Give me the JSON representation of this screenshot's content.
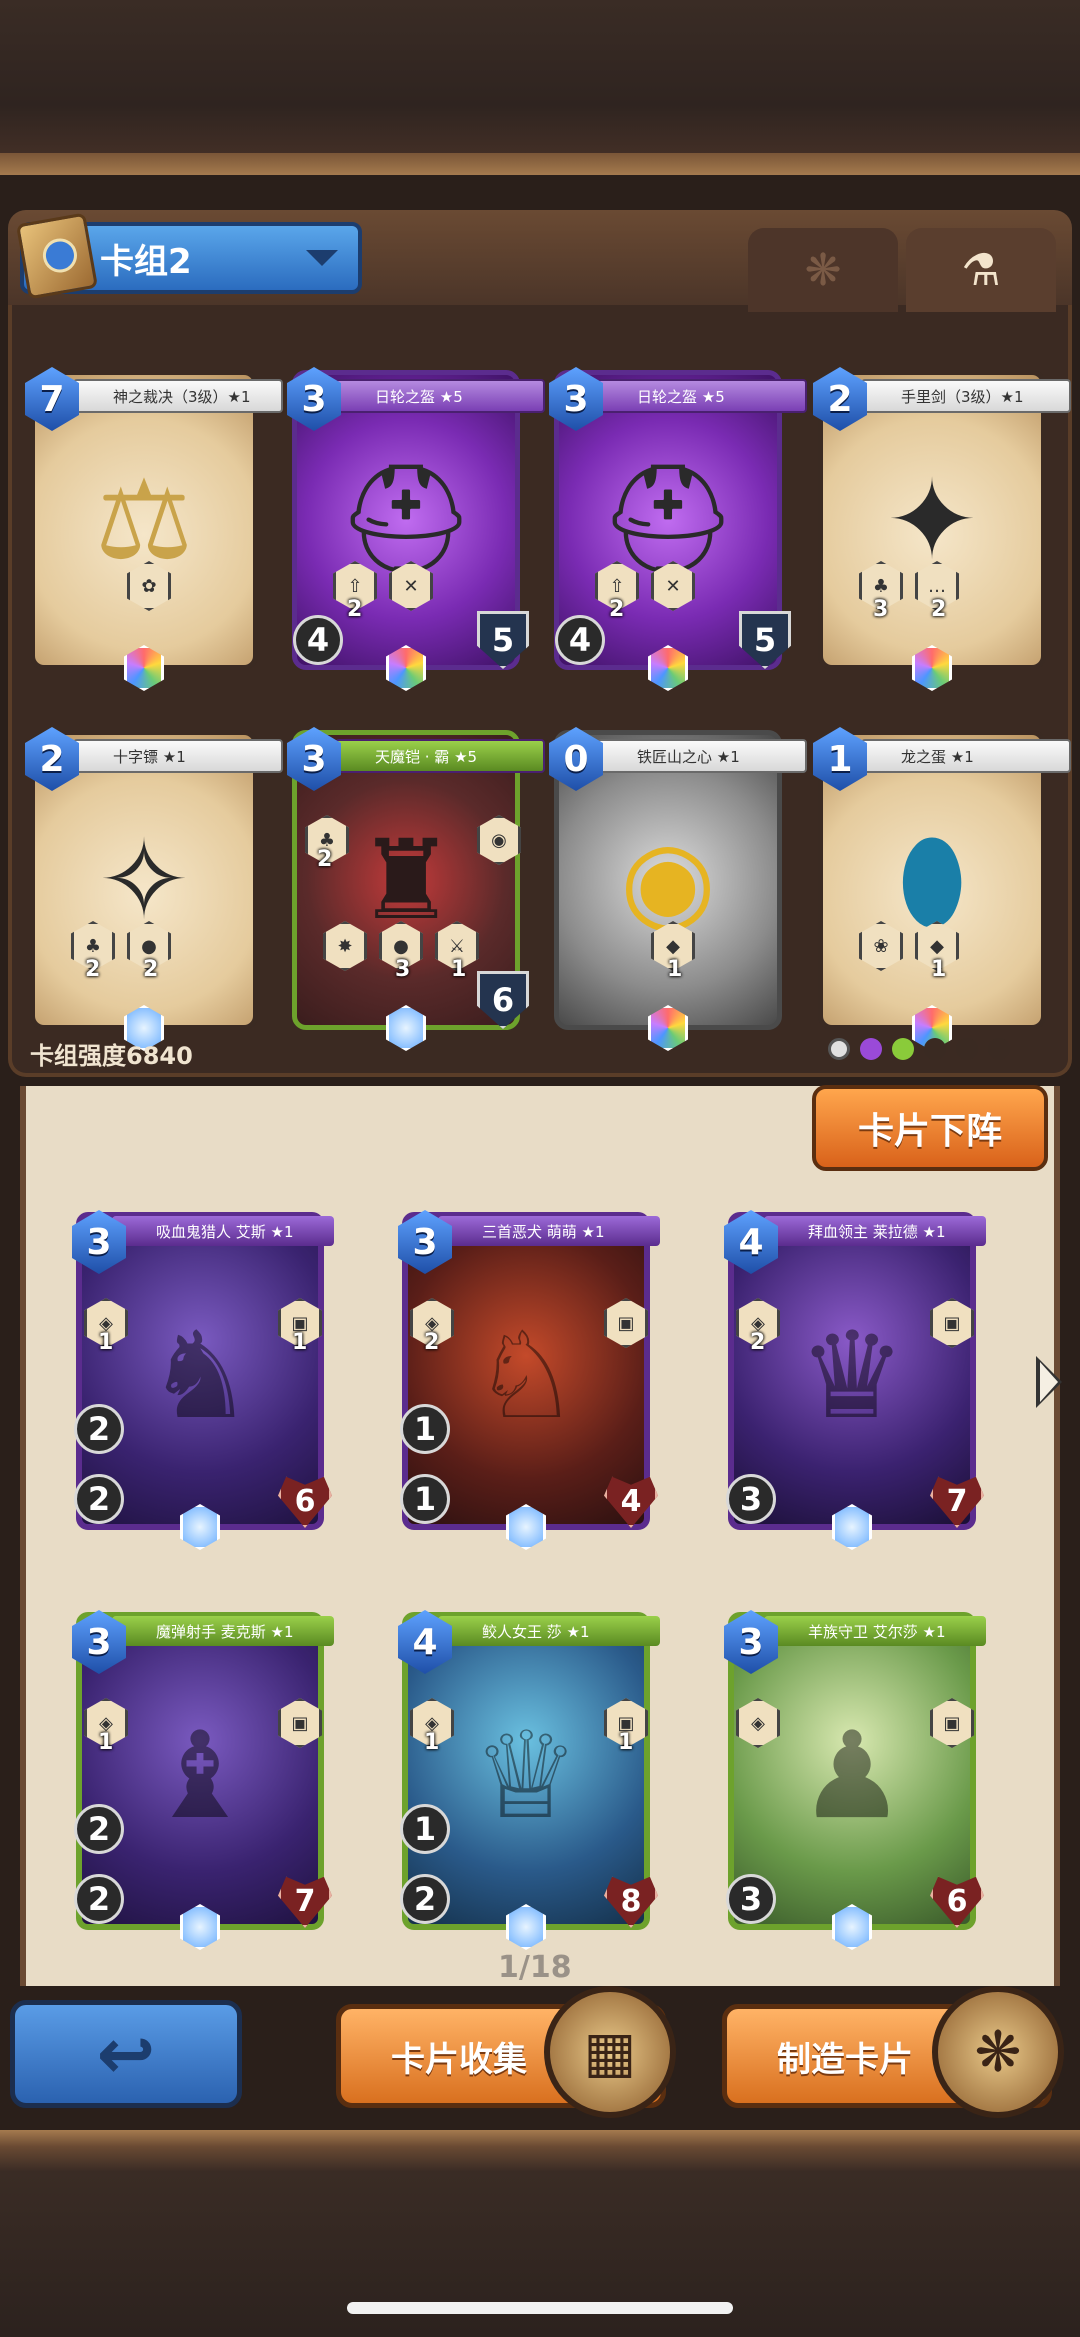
{
  "deck": {
    "name": "卡组2",
    "strength_label": "卡组强度6840"
  },
  "tabs": {
    "pets_icon": "paw-icon",
    "potions_icon": "potion-icon"
  },
  "deck_cards": [
    {
      "cost": "7",
      "name": "神之裁决（3级）★1"
    },
    {
      "cost": "3",
      "name": "日轮之盔 ★5",
      "stat_left": "4",
      "stat_right": "5",
      "skill_a": "2"
    },
    {
      "cost": "3",
      "name": "日轮之盔 ★5",
      "stat_left": "4",
      "stat_right": "5",
      "skill_a": "2"
    },
    {
      "cost": "2",
      "name": "手里剑（3级）★1",
      "skill_a": "3",
      "skill_b": "2"
    },
    {
      "cost": "2",
      "name": "十字镖 ★1",
      "skill_a": "2",
      "skill_b": "2"
    },
    {
      "cost": "3",
      "name": "天魔铠 · 霸 ★5",
      "skill_side": "2",
      "skill_b": "3",
      "skill_c": "1",
      "stat_right": "6"
    },
    {
      "cost": "0",
      "name": "铁匠山之心 ★1",
      "skill_b": "1"
    },
    {
      "cost": "1",
      "name": "龙之蛋 ★1",
      "skill_b": "1"
    }
  ],
  "unload_button": "卡片下阵",
  "collection_cards": [
    {
      "cost": "3",
      "name": "吸血鬼猎人 艾斯 ★1",
      "s1": "1",
      "s2": "1",
      "atk": "2",
      "def": "2",
      "hp": "6"
    },
    {
      "cost": "3",
      "name": "三首恶犬 萌萌 ★1",
      "s1": "2",
      "s2": "",
      "atk": "1",
      "def": "1",
      "hp": "4"
    },
    {
      "cost": "4",
      "name": "拜血领主 莱拉德 ★1",
      "s1": "2",
      "s2": "",
      "atk": "",
      "def": "3",
      "hp": "7"
    },
    {
      "cost": "3",
      "name": "魔弹射手 麦克斯 ★1",
      "s1": "1",
      "s2": "",
      "atk": "2",
      "def": "2",
      "hp": "7"
    },
    {
      "cost": "4",
      "name": "鲛人女王 莎 ★1",
      "s1": "1",
      "s2": "1",
      "atk": "1",
      "def": "2",
      "hp": "8"
    },
    {
      "cost": "3",
      "name": "羊族守卫 艾尔莎 ★1",
      "s1": "",
      "s2": "",
      "atk": "",
      "def": "3",
      "hp": "6"
    }
  ],
  "pagination": "1/18",
  "bottom": {
    "back_icon": "back-arrow-icon",
    "collect_label": "卡片收集",
    "craft_label": "制造卡片"
  }
}
